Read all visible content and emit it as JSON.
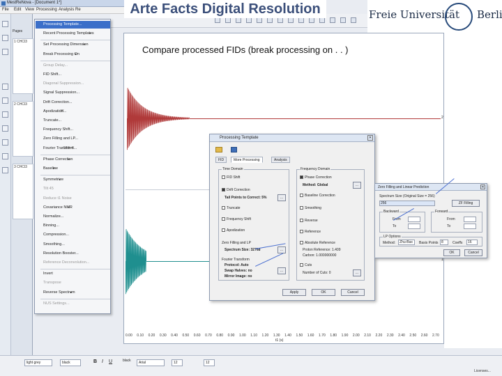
{
  "window": {
    "title": "MestReNova - [Document 1*]"
  },
  "menubar": {
    "items": [
      "File",
      "Edit",
      "View",
      "Processing",
      "Analysis",
      "Re"
    ]
  },
  "slide": {
    "title": "Arte Facts Digital Resolution",
    "subtitle": "Compare  processed FIDs (break processing on . . )"
  },
  "logo": {
    "left": "Freie Universität",
    "right": "Berlin"
  },
  "left_panel": {
    "label": "Pages",
    "thumbs": [
      "1 CHCl3",
      "2 CHCl3",
      "3 CHCl3"
    ]
  },
  "processing_menu": {
    "items": [
      {
        "label": "Processing Template...",
        "selected": true,
        "disabled": false,
        "submenu": false,
        "shortcut": ""
      },
      {
        "label": "Recent Processing Templates",
        "selected": false,
        "disabled": false,
        "submenu": true,
        "shortcut": ""
      },
      {
        "label": "Set Processing Dimension",
        "selected": false,
        "disabled": false,
        "submenu": true,
        "shortcut": ""
      },
      {
        "label": "Break Processing On",
        "selected": false,
        "disabled": false,
        "submenu": true,
        "shortcut": ""
      },
      {
        "label": "Group Delay...",
        "selected": false,
        "disabled": true,
        "submenu": false,
        "shortcut": ""
      },
      {
        "label": "FID Shift...",
        "selected": false,
        "disabled": false,
        "submenu": false,
        "shortcut": ""
      },
      {
        "label": "Diagonal Suppression...",
        "selected": false,
        "disabled": true,
        "submenu": false,
        "shortcut": ""
      },
      {
        "label": "Signal Suppression...",
        "selected": false,
        "disabled": false,
        "submenu": false,
        "shortcut": ""
      },
      {
        "label": "Drift Correction...",
        "selected": false,
        "disabled": false,
        "submenu": false,
        "shortcut": ""
      },
      {
        "label": "Apodization...",
        "selected": false,
        "disabled": false,
        "submenu": false,
        "shortcut": "W"
      },
      {
        "label": "Truncate...",
        "selected": false,
        "disabled": false,
        "submenu": false,
        "shortcut": ""
      },
      {
        "label": "Frequency Shift...",
        "selected": false,
        "disabled": false,
        "submenu": false,
        "shortcut": ""
      },
      {
        "label": "Zero Filling and LP...",
        "selected": false,
        "disabled": false,
        "submenu": false,
        "shortcut": ""
      },
      {
        "label": "Fourier Transform...",
        "selected": false,
        "disabled": false,
        "submenu": false,
        "shortcut": "Shift+F"
      },
      {
        "label": "Phase Correction",
        "selected": false,
        "disabled": false,
        "submenu": true,
        "shortcut": ""
      },
      {
        "label": "Baseline",
        "selected": false,
        "disabled": false,
        "submenu": true,
        "shortcut": ""
      },
      {
        "label": "Symmetrize",
        "selected": false,
        "disabled": false,
        "submenu": true,
        "shortcut": ""
      },
      {
        "label": "Tilt 45",
        "selected": false,
        "disabled": true,
        "submenu": false,
        "shortcut": ""
      },
      {
        "label": "Reduce t1 Noise",
        "selected": false,
        "disabled": true,
        "submenu": false,
        "shortcut": ""
      },
      {
        "label": "Covariance NMR",
        "selected": false,
        "disabled": false,
        "submenu": true,
        "shortcut": ""
      },
      {
        "label": "Normalize...",
        "selected": false,
        "disabled": false,
        "submenu": false,
        "shortcut": ""
      },
      {
        "label": "Binning...",
        "selected": false,
        "disabled": false,
        "submenu": false,
        "shortcut": ""
      },
      {
        "label": "Compression...",
        "selected": false,
        "disabled": false,
        "submenu": false,
        "shortcut": ""
      },
      {
        "label": "Smoothing...",
        "selected": false,
        "disabled": false,
        "submenu": false,
        "shortcut": ""
      },
      {
        "label": "Resolution Booster...",
        "selected": false,
        "disabled": false,
        "submenu": false,
        "shortcut": ""
      },
      {
        "label": "Reference Deconvolution...",
        "selected": false,
        "disabled": true,
        "submenu": false,
        "shortcut": ""
      },
      {
        "label": "Invert",
        "selected": false,
        "disabled": false,
        "submenu": false,
        "shortcut": ""
      },
      {
        "label": "Transpose",
        "selected": false,
        "disabled": true,
        "submenu": false,
        "shortcut": ""
      },
      {
        "label": "Reverse Spectrum",
        "selected": false,
        "disabled": false,
        "submenu": true,
        "shortcut": ""
      },
      {
        "label": "NUS Settings...",
        "selected": false,
        "disabled": true,
        "submenu": false,
        "shortcut": ""
      }
    ]
  },
  "plot": {
    "x_ticks": [
      "0.00",
      "0.10",
      "0.20",
      "0.30",
      "0.40",
      "0.50",
      "0.60",
      "0.70",
      "0.80",
      "0.90",
      "1.00",
      "1.10",
      "1.20",
      "1.30",
      "1.40",
      "1.50",
      "1.60",
      "1.70",
      "1.80",
      "1.90",
      "2.00",
      "2.10",
      "2.20",
      "2.30",
      "2.40",
      "2.50",
      "2.60",
      "2.70"
    ],
    "x_unit": "t1 (s)",
    "right_labels": [
      "2",
      "1"
    ],
    "fid_colors": {
      "fid1": "#b03a3a",
      "fid2": "#1f8f8f"
    }
  },
  "processing_dialog": {
    "title": "Processing Template",
    "tabs": [
      "More Processing",
      "Analysis"
    ],
    "time_domain": {
      "label": "Time Domain",
      "items": [
        "FID Shift",
        "Drift Correction",
        "Truncate",
        "Frequency Shift",
        "Apodization",
        "Zero Filling and LP"
      ],
      "drift_field": "Tail Points to Correct: 5%",
      "zf_field": "Spectrum Size: 32768",
      "ft_label": "Fourier Transform",
      "ft_fields": [
        "Protocol: Auto",
        "Swap Halves: no",
        "Mirror Image: no"
      ]
    },
    "freq_domain": {
      "label": "Frequency Domain",
      "items": [
        "Phase Correction",
        "Baseline Correction",
        "Smoothing",
        "Reverse",
        "Reference",
        "Absolute Reference",
        "Cuts"
      ],
      "phase_field": "Method: Global",
      "ref_fields": [
        "Proton Reference: 1.409",
        "Carbon: 1.000000000"
      ],
      "cuts_field": "Number of Cuts: 0"
    },
    "buttons": [
      "Apply",
      "OK",
      "Cancel"
    ]
  },
  "zf_dialog": {
    "title": "Zero Filling and Linear Prediction",
    "spectrum_size_label": "Spectrum Size (Original Size = 256)",
    "spectrum_size_value": "256",
    "zf_button": "ZF Filling",
    "backward_label": "Backward",
    "forward_label": "Forward",
    "from_label": "From",
    "to_label": "To",
    "lp_label": "LP Options",
    "method_label": "Method:",
    "method_value": "Zhu-Bax",
    "basis_label": "Basis Points",
    "basis_value": "8",
    "coeffs_label": "Coeffs",
    "coeffs_value": "16",
    "buttons": [
      "OK",
      "Cancel"
    ]
  },
  "statusbar": {
    "fields": [
      "light grey",
      "black",
      "Arial",
      "12",
      "black",
      "12"
    ],
    "license": "Licenses..."
  }
}
